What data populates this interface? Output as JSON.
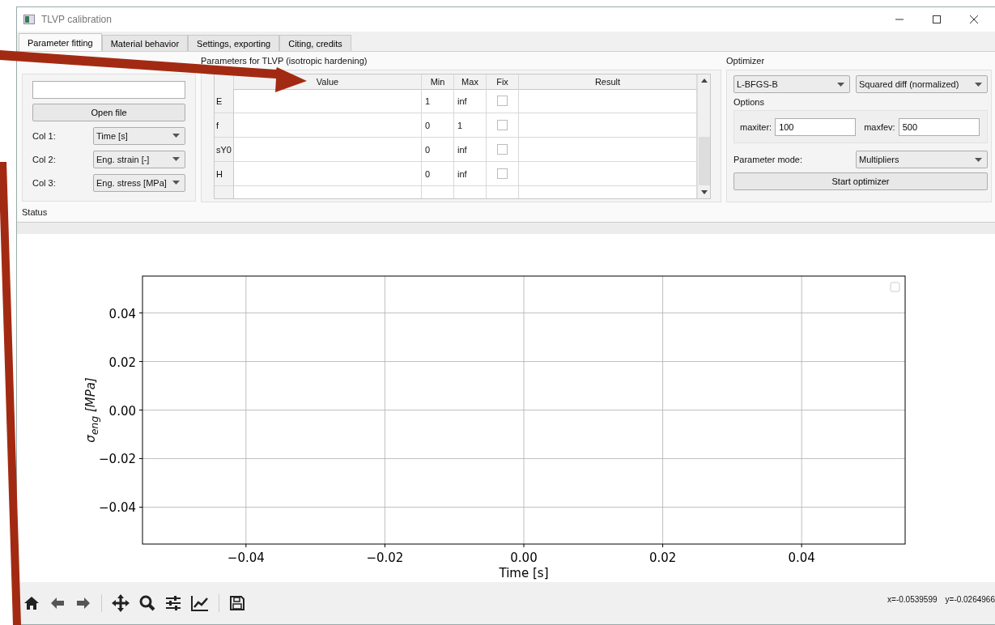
{
  "window": {
    "title": "TLVP calibration"
  },
  "tabs": [
    {
      "label": "Parameter fitting",
      "selected": true
    },
    {
      "label": "Material behavior",
      "selected": false
    },
    {
      "label": "Settings, exporting",
      "selected": false
    },
    {
      "label": "Citing, credits",
      "selected": false
    }
  ],
  "input": {
    "open_button": "Open file",
    "columns": [
      {
        "label": "Col 1:",
        "value": "Time [s]"
      },
      {
        "label": "Col 2:",
        "value": "Eng. strain [-]"
      },
      {
        "label": "Col 3:",
        "value": "Eng. stress [MPa]"
      }
    ]
  },
  "parameters": {
    "title": "Parameters for TLVP (isotropic hardening)",
    "columns": [
      "Value",
      "Min",
      "Max",
      "Fix",
      "Result"
    ],
    "rows": [
      {
        "name": "E",
        "min": "1",
        "max": "inf",
        "fix": false
      },
      {
        "name": "f",
        "min": "0",
        "max": "1",
        "fix": false
      },
      {
        "name": "sY0",
        "min": "0",
        "max": "inf",
        "fix": false
      },
      {
        "name": "H",
        "min": "0",
        "max": "inf",
        "fix": false
      }
    ]
  },
  "optimizer": {
    "title": "Optimizer",
    "method": "L-BFGS-B",
    "objective": "Squared diff (normalized)",
    "options_title": "Options",
    "fields": [
      {
        "label": "maxiter:",
        "value": "100"
      },
      {
        "label": "maxfev:",
        "value": "500"
      }
    ],
    "mode_label": "Parameter mode:",
    "mode": "Multipliers",
    "start_button": "Start optimizer"
  },
  "status": {
    "label": "Status"
  },
  "plot": {
    "chart_data": {
      "type": "line",
      "grid": true,
      "xlabel": "Time [s]",
      "ylabel": "σ$_{eng}$ [MPa]",
      "xlim": [
        -0.0549,
        0.0549
      ],
      "ylim": [
        -0.0552,
        0.0552
      ],
      "xticks": [
        {
          "value": -0.04,
          "label": "−0.04"
        },
        {
          "value": -0.02,
          "label": "−0.02"
        },
        {
          "value": 0,
          "label": "0.00"
        },
        {
          "value": 0.02,
          "label": "0.02"
        },
        {
          "value": 0.04,
          "label": "0.04"
        }
      ],
      "yticks": [
        {
          "value": -0.04,
          "label": "−0.04"
        },
        {
          "value": -0.02,
          "label": "−0.02"
        },
        {
          "value": 0,
          "label": "0.00"
        },
        {
          "value": 0.02,
          "label": "0.02"
        },
        {
          "value": 0.04,
          "label": "0.04"
        }
      ]
    },
    "coordinates": [
      "x=-0.0539599",
      "y=-0.0264966"
    ]
  }
}
